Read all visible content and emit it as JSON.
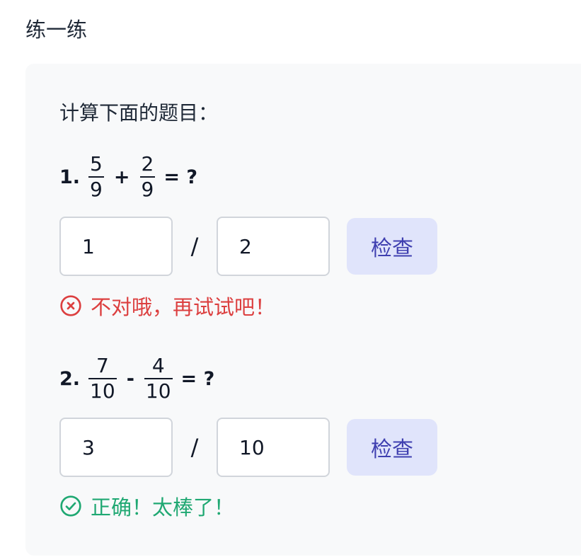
{
  "section_title": "练一练",
  "instruction": "计算下面的题目：",
  "problems": [
    {
      "number": "1.",
      "frac1": {
        "num": "5",
        "den": "9"
      },
      "operator": "+",
      "frac2": {
        "num": "2",
        "den": "9"
      },
      "equals": "= ?",
      "answer": {
        "numerator": "1",
        "denominator": "2"
      },
      "slash": "/",
      "check_label": "检查",
      "feedback": {
        "status": "error",
        "icon": "x-circle-icon",
        "text": "不对哦，再试试吧！"
      }
    },
    {
      "number": "2.",
      "frac1": {
        "num": "7",
        "den": "10"
      },
      "operator": "-",
      "frac2": {
        "num": "4",
        "den": "10"
      },
      "equals": "= ?",
      "answer": {
        "numerator": "3",
        "denominator": "10"
      },
      "slash": "/",
      "check_label": "检查",
      "feedback": {
        "status": "success",
        "icon": "check-circle-icon",
        "text": "正确！太棒了！"
      }
    }
  ],
  "colors": {
    "card_bg": "#f8f9fa",
    "button_bg": "#e0e4fb",
    "button_text": "#3f3fb0",
    "error": "#dc3f3f",
    "success": "#1fa872"
  }
}
